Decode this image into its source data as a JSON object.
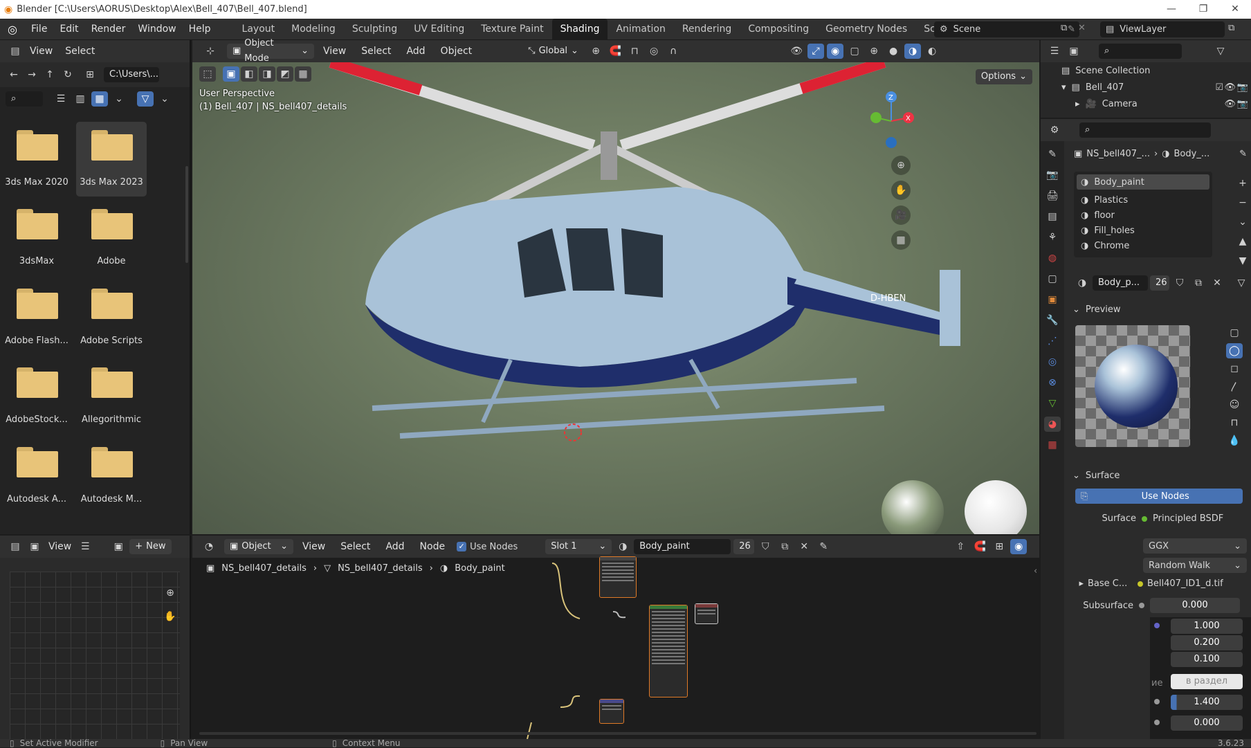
{
  "window": {
    "title": "Blender [C:\\Users\\AORUS\\Desktop\\Alex\\Bell_407\\Bell_407.blend]",
    "minimize": "—",
    "maximize": "❐",
    "close": "✕"
  },
  "menu": [
    "File",
    "Edit",
    "Render",
    "Window",
    "Help"
  ],
  "workspaces": [
    {
      "label": "Layout"
    },
    {
      "label": "Modeling"
    },
    {
      "label": "Sculpting"
    },
    {
      "label": "UV Editing"
    },
    {
      "label": "Texture Paint"
    },
    {
      "label": "Shading",
      "active": true
    },
    {
      "label": "Animation"
    },
    {
      "label": "Rendering"
    },
    {
      "label": "Compositing"
    },
    {
      "label": "Geometry Nodes"
    },
    {
      "label": "Scripting"
    }
  ],
  "scene": {
    "label": "Scene"
  },
  "view_layer": {
    "label": "ViewLayer"
  },
  "file_browser": {
    "menu": [
      "View",
      "Select"
    ],
    "path": "C:\\Users\\...",
    "items": [
      {
        "label": "3ds Max 2020"
      },
      {
        "label": "3ds Max 2023",
        "selected": true
      },
      {
        "label": "3dsMax"
      },
      {
        "label": "Adobe"
      },
      {
        "label": "Adobe Flash..."
      },
      {
        "label": "Adobe Scripts"
      },
      {
        "label": "AdobeStock..."
      },
      {
        "label": "Allegorithmic"
      },
      {
        "label": "Autodesk A..."
      },
      {
        "label": "Autodesk M..."
      }
    ]
  },
  "viewport": {
    "mode": "Object Mode",
    "menu": [
      "View",
      "Select",
      "Add",
      "Object"
    ],
    "transform": "Global",
    "options": "Options",
    "overlay_line1": "User Perspective",
    "overlay_line2": "(1) Bell_407 | NS_bell407_details",
    "axes": {
      "z": "Z",
      "x": "X"
    },
    "tail_text": "D-HBEN"
  },
  "image_editor": {
    "view": "View",
    "new": "New"
  },
  "node_editor": {
    "object": "Object",
    "menu": [
      "View",
      "Select",
      "Add",
      "Node"
    ],
    "use_nodes": "Use Nodes",
    "slot": "Slot 1",
    "material": "Body_paint",
    "users": "26",
    "breadcrumb": [
      "NS_bell407_details",
      "NS_bell407_details",
      "Body_paint"
    ]
  },
  "outliner": {
    "title": "Scene Collection",
    "items": [
      {
        "label": "Bell_407"
      },
      {
        "label": "Camera"
      }
    ]
  },
  "properties": {
    "breadcrumb": [
      "NS_bell407_...",
      "Body_..."
    ],
    "materials": [
      "Body_paint",
      "Plastics",
      "floor",
      "Fill_holes",
      "Chrome"
    ],
    "material_name": "Body_p...",
    "material_users": "26",
    "preview_label": "Preview",
    "surface_label": "Surface",
    "use_nodes_button": "Use Nodes",
    "surface_field_label": "Surface",
    "surface_shader": "Principled BSDF",
    "distribution": "GGX",
    "subsurface_method": "Random Walk",
    "base_color_label": "Base C...",
    "base_color_value": "Bell407_ID1_d.tif",
    "subsurface_label": "Subsurface",
    "subsurface_value": "0.000",
    "radius": [
      "1.000",
      "0.200",
      "0.100"
    ],
    "partial_label": "ие",
    "tooltip_text": "в раздел",
    "ior_value": "1.400",
    "last_value": "0.000"
  },
  "status": {
    "left": "Set Active Modifier",
    "middle": "Pan View",
    "right": "Context Menu",
    "version": "3.6.23"
  }
}
